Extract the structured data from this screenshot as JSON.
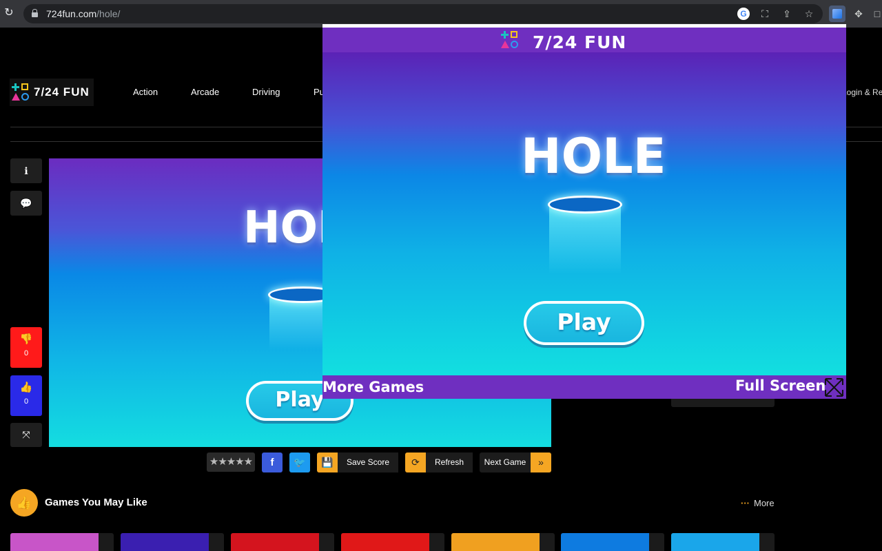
{
  "browser": {
    "url_host": "724fun.com",
    "url_path": "/hole/"
  },
  "site": {
    "logo_text": "7/24 FUN",
    "nav": [
      "Action",
      "Arcade",
      "Driving",
      "Pu"
    ],
    "login": "Login & Reg"
  },
  "side": {
    "dislike_count": "0",
    "like_count": "0"
  },
  "game": {
    "title": "HOLE",
    "play_label": "Play"
  },
  "toolbar": {
    "stars": "★★★★★",
    "save_score": "Save Score",
    "refresh": "Refresh",
    "next_game": "Next Game"
  },
  "related": {
    "title": "Games You May Like",
    "more": "More",
    "thumbnail_colors": [
      "#c855c8",
      "#3a1fb0",
      "#d4141e",
      "#e01818",
      "#f0a020",
      "#0e7be0",
      "#1aa6ea"
    ]
  },
  "popup": {
    "title": "7/24 FUN",
    "game_title": "HOLE",
    "play_label": "Play",
    "more_games": "More Games",
    "full_screen": "Full Screen"
  },
  "colors": {
    "brand_purple": "#6f2fc0",
    "accent_orange": "#f5a623",
    "dislike_red": "#ff1a1a",
    "like_blue": "#2a2ae8"
  }
}
